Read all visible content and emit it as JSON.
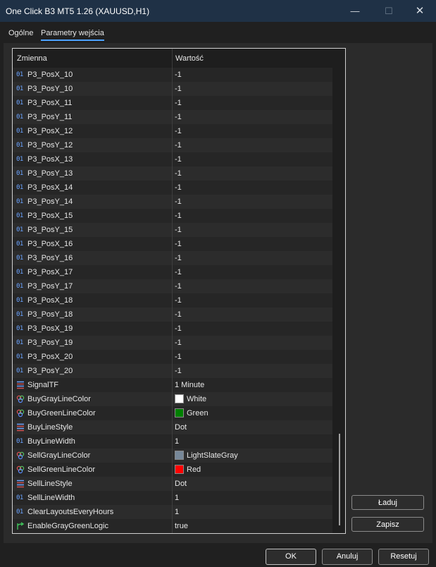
{
  "window": {
    "title": "One Click B3 MT5 1.26 (XAUUSD,H1)",
    "min": "—",
    "max": "☐",
    "close": "✕"
  },
  "tabs": [
    {
      "label": "Ogólne"
    },
    {
      "label": "Parametry wejścia"
    }
  ],
  "table": {
    "col_name": "Zmienna",
    "col_value": "Wartość",
    "rows": [
      {
        "type": "int",
        "name": "P3_PosX_10",
        "value": "-1"
      },
      {
        "type": "int",
        "name": "P3_PosY_10",
        "value": "-1"
      },
      {
        "type": "int",
        "name": "P3_PosX_11",
        "value": "-1"
      },
      {
        "type": "int",
        "name": "P3_PosY_11",
        "value": "-1"
      },
      {
        "type": "int",
        "name": "P3_PosX_12",
        "value": "-1"
      },
      {
        "type": "int",
        "name": "P3_PosY_12",
        "value": "-1"
      },
      {
        "type": "int",
        "name": "P3_PosX_13",
        "value": "-1"
      },
      {
        "type": "int",
        "name": "P3_PosY_13",
        "value": "-1"
      },
      {
        "type": "int",
        "name": "P3_PosX_14",
        "value": "-1"
      },
      {
        "type": "int",
        "name": "P3_PosY_14",
        "value": "-1"
      },
      {
        "type": "int",
        "name": "P3_PosX_15",
        "value": "-1"
      },
      {
        "type": "int",
        "name": "P3_PosY_15",
        "value": "-1"
      },
      {
        "type": "int",
        "name": "P3_PosX_16",
        "value": "-1"
      },
      {
        "type": "int",
        "name": "P3_PosY_16",
        "value": "-1"
      },
      {
        "type": "int",
        "name": "P3_PosX_17",
        "value": "-1"
      },
      {
        "type": "int",
        "name": "P3_PosY_17",
        "value": "-1"
      },
      {
        "type": "int",
        "name": "P3_PosX_18",
        "value": "-1"
      },
      {
        "type": "int",
        "name": "P3_PosY_18",
        "value": "-1"
      },
      {
        "type": "int",
        "name": "P3_PosX_19",
        "value": "-1"
      },
      {
        "type": "int",
        "name": "P3_PosY_19",
        "value": "-1"
      },
      {
        "type": "int",
        "name": "P3_PosX_20",
        "value": "-1"
      },
      {
        "type": "int",
        "name": "P3_PosY_20",
        "value": "-1"
      },
      {
        "type": "enum",
        "name": "SignalTF",
        "value": "1 Minute"
      },
      {
        "type": "color",
        "name": "BuyGrayLineColor",
        "value": "White",
        "swatch": "#ffffff"
      },
      {
        "type": "color",
        "name": "BuyGreenLineColor",
        "value": "Green",
        "swatch": "#008000"
      },
      {
        "type": "enum",
        "name": "BuyLineStyle",
        "value": "Dot"
      },
      {
        "type": "int",
        "name": "BuyLineWidth",
        "value": "1"
      },
      {
        "type": "color",
        "name": "SellGrayLineColor",
        "value": "LightSlateGray",
        "swatch": "#778899"
      },
      {
        "type": "color",
        "name": "SellGreenLineColor",
        "value": "Red",
        "swatch": "#ff0000"
      },
      {
        "type": "enum",
        "name": "SellLineStyle",
        "value": "Dot"
      },
      {
        "type": "int",
        "name": "SellLineWidth",
        "value": "1"
      },
      {
        "type": "int",
        "name": "ClearLayoutsEveryHours",
        "value": "1"
      },
      {
        "type": "bool",
        "name": "EnableGrayGreenLogic",
        "value": "true"
      }
    ]
  },
  "side_buttons": {
    "load": "Ładuj",
    "save": "Zapisz"
  },
  "footer": {
    "ok": "OK",
    "cancel": "Anuluj",
    "reset": "Resetuj"
  },
  "icons": {
    "int": "01",
    "enum": "enum-lines-icon",
    "color": "palette-icon",
    "bool": "branch-icon"
  }
}
